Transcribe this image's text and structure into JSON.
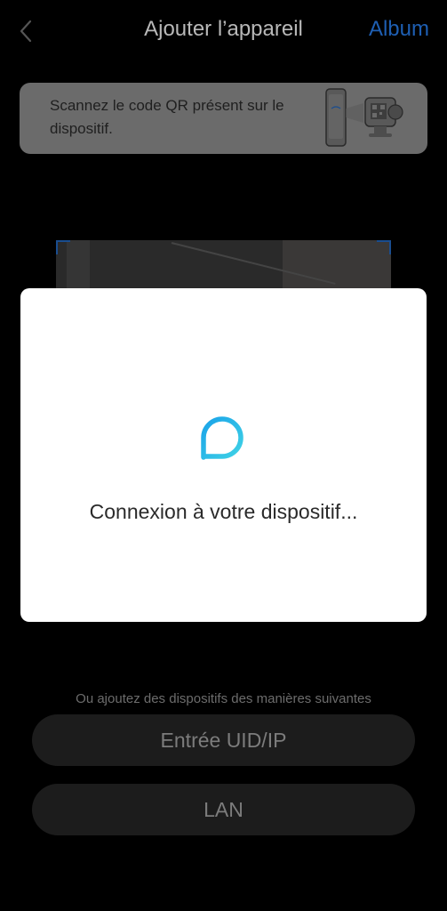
{
  "header": {
    "title": "Ajouter l’appareil",
    "album_label": "Album"
  },
  "hint": {
    "text": "Scannez le code QR présent sur le dispositif."
  },
  "modal": {
    "message": "Connexion à votre dispositif..."
  },
  "alternatives": {
    "caption": "Ou ajoutez des dispositifs des manières suivantes",
    "uid_ip_label": "Entrée UID/IP",
    "lan_label": "LAN"
  },
  "colors": {
    "accent": "#1e5fb3",
    "spinner_start": "#1aa3e8",
    "spinner_end": "#3fd2e6"
  },
  "icons": {
    "back": "chevron-left-icon",
    "spinner": "loading-icon",
    "illustration": "phone-scan-camera-illustration"
  }
}
